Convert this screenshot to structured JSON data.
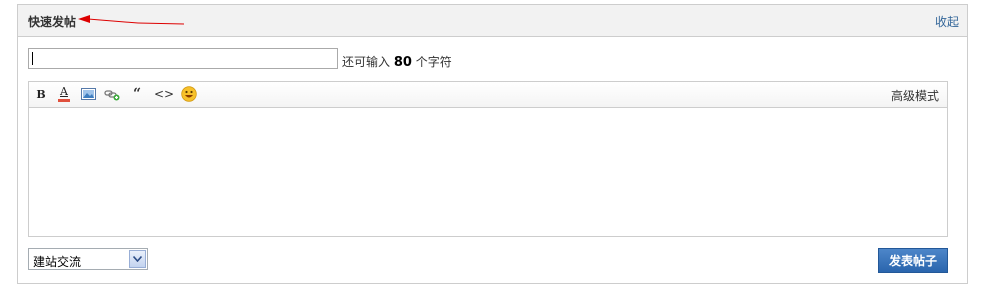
{
  "header": {
    "title": "快速发帖",
    "collapse_label": "收起"
  },
  "subject": {
    "value": "",
    "count_prefix": "还可输入",
    "count_value": "80",
    "count_suffix": "个字符"
  },
  "editor": {
    "toolbar_icons": [
      "bold-icon",
      "font-color-icon",
      "image-icon",
      "link-icon",
      "quote-icon",
      "code-icon",
      "smiley-icon"
    ],
    "bold_glyph": "B",
    "font_color_glyph": "A",
    "quote_glyph": "“",
    "code_glyph": "<>",
    "advanced_label": "高级模式",
    "content": ""
  },
  "forum_select": {
    "selected": "建站交流"
  },
  "submit": {
    "label": "发表帖子"
  },
  "colors": {
    "accent": "#2a65ad",
    "link": "#336699",
    "annotation_arrow": "#dd0000"
  }
}
